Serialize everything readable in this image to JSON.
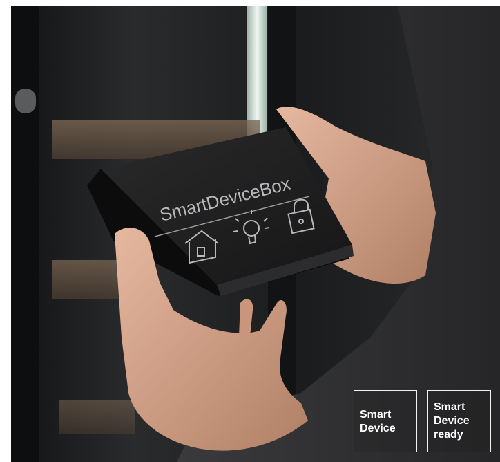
{
  "photo": {
    "box_brand_text": "SmartDeviceBox",
    "icons": [
      "house-icon",
      "light-bulb-icon",
      "padlock-icon"
    ],
    "colors": {
      "background": "#1c1d1f",
      "box_top": "#1f1f20",
      "box_edge": "#0d0d0e",
      "skin": "#d9a88e",
      "sleeve": "#2e2e30",
      "shelf_wood": "#6b5a48",
      "highlight": "#e8f2ec"
    }
  },
  "badges": [
    {
      "lines": [
        "Smart",
        "Device"
      ]
    },
    {
      "lines": [
        "Smart",
        "Device",
        "ready"
      ]
    }
  ]
}
